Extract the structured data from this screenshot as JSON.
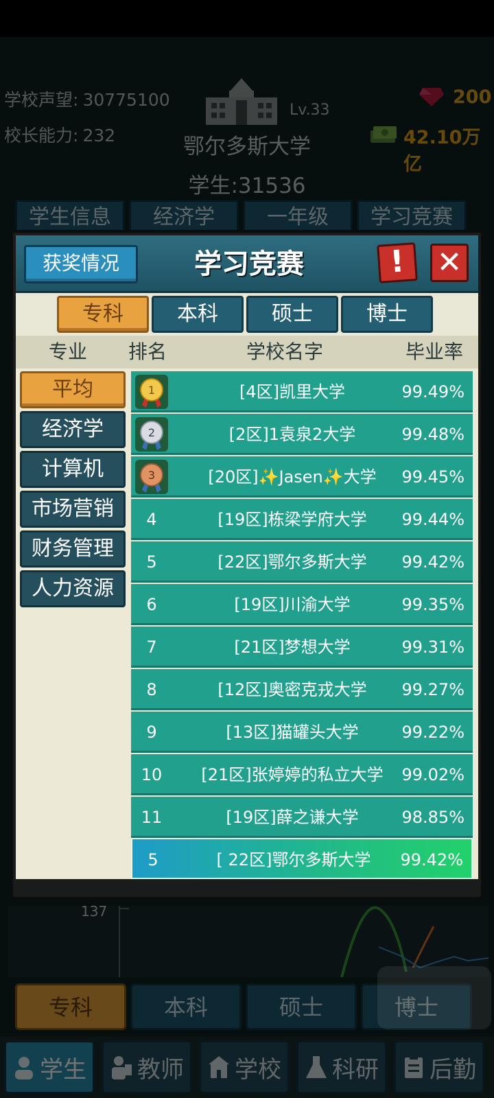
{
  "header": {
    "prestige_label": "学校声望:",
    "prestige_value": "30775100",
    "ability_label": "校长能力:",
    "ability_value": "232",
    "level": "Lv.33",
    "school_name": "鄂尔多斯大学",
    "students_label": "学生:",
    "students_value": "31536",
    "gems": "200",
    "cash": "42.10万亿"
  },
  "bg_tabs": [
    "学生信息",
    "经济学",
    "一年级",
    "学习竞赛"
  ],
  "bg_chart": {
    "axis_label": "137"
  },
  "bg_levels": [
    "专科",
    "本科",
    "硕士",
    "博士"
  ],
  "bottom_nav": [
    "学生",
    "教师",
    "学校",
    "科研",
    "后勤"
  ],
  "modal": {
    "award_button": "获奖情况",
    "title": "学习竞赛",
    "alert_glyph": "!",
    "close_glyph": "✕",
    "levels": [
      "专科",
      "本科",
      "硕士",
      "博士"
    ],
    "columns": {
      "major": "专业",
      "rank": "排名",
      "school": "学校名字",
      "rate": "毕业率"
    },
    "majors": [
      "平均",
      "经济学",
      "计算机",
      "市场营销",
      "财务管理",
      "人力资源"
    ],
    "rows": [
      {
        "rank": "1",
        "school": "[4区]凯里大学",
        "rate": "99.49%"
      },
      {
        "rank": "2",
        "school": "[2区]1袁泉2大学",
        "rate": "99.48%"
      },
      {
        "rank": "3",
        "school": "[20区]✨Jasen✨大学",
        "rate": "99.45%"
      },
      {
        "rank": "4",
        "school": "[19区]栋梁学府大学",
        "rate": "99.44%"
      },
      {
        "rank": "5",
        "school": "[22区]鄂尔多斯大学",
        "rate": "99.42%"
      },
      {
        "rank": "6",
        "school": "[19区]川渝大学",
        "rate": "99.35%"
      },
      {
        "rank": "7",
        "school": "[21区]梦想大学",
        "rate": "99.31%"
      },
      {
        "rank": "8",
        "school": "[12区]奥密克戎大学",
        "rate": "99.27%"
      },
      {
        "rank": "9",
        "school": "[13区]猫罐头大学",
        "rate": "99.22%"
      },
      {
        "rank": "10",
        "school": "[21区]张婷婷的私立大学",
        "rate": "99.02%"
      },
      {
        "rank": "11",
        "school": "[19区]薛之谦大学",
        "rate": "98.85%"
      }
    ],
    "mine": {
      "rank": "5",
      "school": "[ 22区]鄂尔多斯大学",
      "rate": "99.42%"
    }
  },
  "colors": {
    "row": "#21a08e",
    "accent": "#e8a340",
    "close": "#c9302a",
    "gold": "#e3a21a"
  }
}
